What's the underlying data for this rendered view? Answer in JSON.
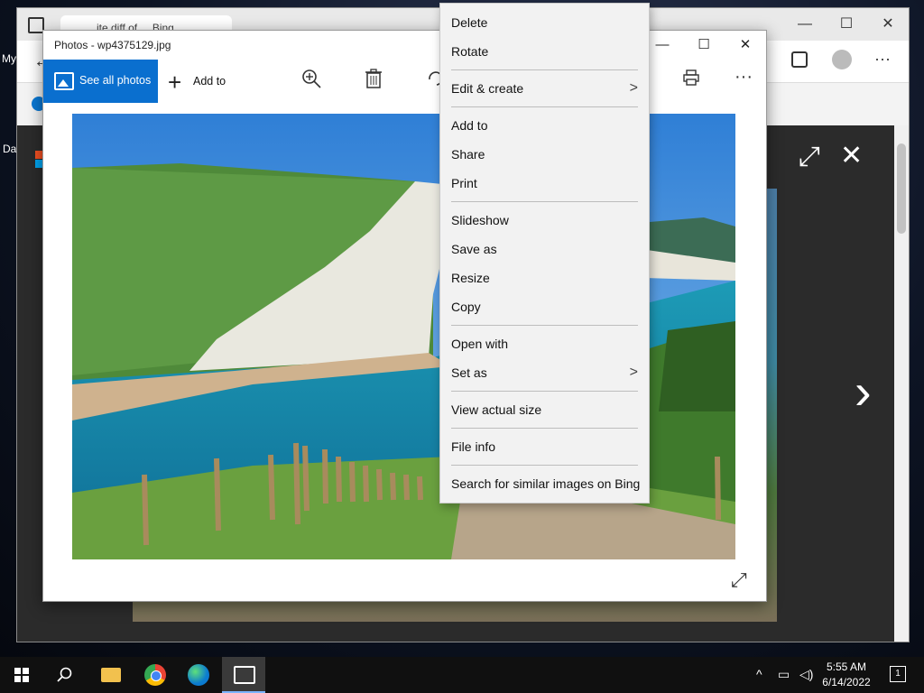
{
  "desktop": {
    "label_my": "My",
    "label_da": "Da"
  },
  "browser": {
    "tab_title": "...ite diff of ... Bing...",
    "minimize": "—",
    "maximize": "☐",
    "close": "✕",
    "more": "···"
  },
  "viewer": {
    "next": "›",
    "close": "✕",
    "expand": "⤢"
  },
  "photos": {
    "title": "Photos - wp4375129.jpg",
    "minimize": "—",
    "maximize": "☐",
    "close": "✕",
    "toolbar": {
      "see_all": "See all photos",
      "add_to": "Add to",
      "more": "···"
    }
  },
  "context_menu": {
    "items": [
      "Delete",
      "Rotate",
      "Edit & create",
      "Add to",
      "Share",
      "Print",
      "Slideshow",
      "Save as",
      "Resize",
      "Copy",
      "Open with",
      "Set as",
      "View actual size",
      "File info",
      "Search for similar images on Bing"
    ],
    "chevron": ">"
  },
  "taskbar": {
    "time": "5:55 AM",
    "date": "6/14/2022",
    "notification_count": "1"
  },
  "colors": {
    "accent": "#0a6fcf",
    "menu_bg": "#f2f2f2",
    "taskbar": "#101010"
  }
}
